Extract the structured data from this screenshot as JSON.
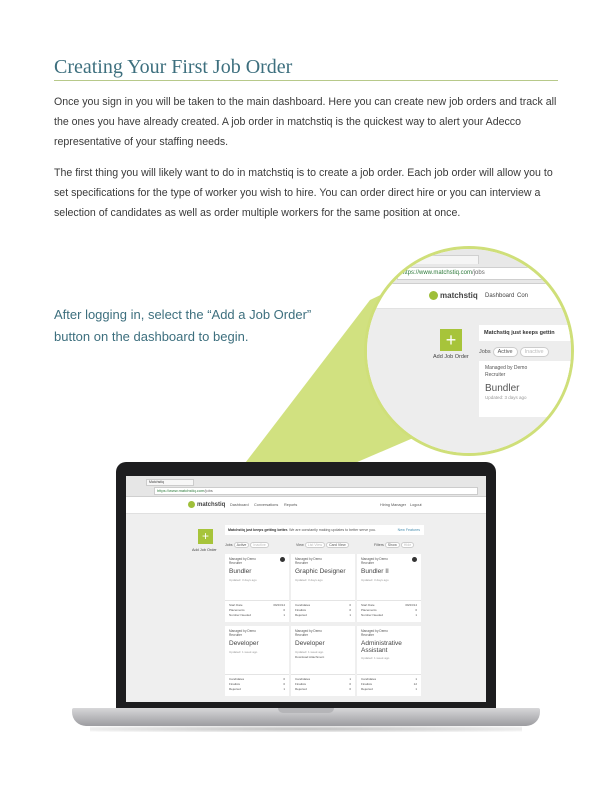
{
  "page": {
    "title": "Creating Your First Job Order",
    "paragraph1": "Once you sign in you will be taken to the main dashboard. Here you can create new job orders and track all the ones you have already created. A job order in matchstiq is the quickest way to alert your Adecco representative of your staffing needs.",
    "paragraph2": "The first thing you will likely want to do in matchstiq is to create a job order. Each job order will allow you to set specifications for the type of worker you wish to hire. You can order direct hire or you can interview a selection of candidates as well as order multiple workers for the same position at once.",
    "callout": "After logging in, select the “Add a Job Order” button on the dashboard to begin.",
    "accent_color": "#a7c43a",
    "title_color": "#3d6f7e"
  },
  "magnifier": {
    "url_host": "https://www.matchstiq.com",
    "url_path": "/jobs",
    "logo": "matchstiq",
    "nav_dashboard": "Dashboard",
    "nav_partial": "Con",
    "add_icon": "+",
    "add_label": "Add Job Order",
    "banner": "Matchstiq just keeps gettin",
    "jobs_label": "Jobs",
    "pill_active": "Active",
    "pill_inactive": "Inactive",
    "card_managed": "Managed by Demo",
    "card_recruiter": "Recruiter",
    "card_title": "Bundler",
    "card_updated": "Updated: 3 days ago"
  },
  "screen": {
    "tab": "Matchstiq",
    "url_host": "https://www.matchstiq.com",
    "url_path": "/jobs",
    "logo": "matchstiq",
    "nav": [
      "Dashboard",
      "Conversations",
      "Reports"
    ],
    "user": "Hiring Manager",
    "logout": "Logout",
    "add_icon": "+",
    "add_label": "Add Job Order",
    "banner_bold": "Matchstiq just keeps getting better.",
    "banner_text": "We are constantly making updates to better serve you.",
    "banner_link": "New Features",
    "jobs_label": "Jobs",
    "jobs_active": "Active",
    "jobs_inactive": "Inactive",
    "view_label": "View",
    "view_list": "List View",
    "view_card": "Card View",
    "filters_label": "Filters",
    "filter_show": "Show",
    "filter_hide": "Hide",
    "cards": [
      {
        "managed": "Managed by Demo",
        "recruiter": "Recruiter",
        "title": "Bundler",
        "updated": "Updated: 3 days ago",
        "extra": "",
        "stats": [
          [
            "Start Date",
            "09/23/14"
          ],
          [
            "Placements",
            "0"
          ],
          [
            "Number Needed",
            "1"
          ]
        ]
      },
      {
        "managed": "Managed by Demo",
        "recruiter": "Recruiter",
        "title": "Graphic Designer",
        "updated": "Updated: 3 days ago",
        "extra": "",
        "stats": [
          [
            "Candidates",
            "0"
          ],
          [
            "Finalists",
            "0"
          ],
          [
            "Rejected",
            "1"
          ]
        ]
      },
      {
        "managed": "Managed by Demo",
        "recruiter": "Recruiter",
        "title": "Bundler II",
        "updated": "Updated: 3 days ago",
        "extra": "",
        "stats": [
          [
            "Start Date",
            "09/23/14"
          ],
          [
            "Placements",
            "0"
          ],
          [
            "Number Needed",
            "1"
          ]
        ]
      },
      {
        "managed": "Managed by Demo",
        "recruiter": "Recruiter",
        "title": "Developer",
        "updated": "Updated: 1 week ago",
        "extra": "",
        "stats": [
          [
            "Candidates",
            "0"
          ],
          [
            "Finalists",
            "0"
          ],
          [
            "Rejected",
            "1"
          ]
        ]
      },
      {
        "managed": "Managed by Demo",
        "recruiter": "Recruiter",
        "title": "Developer",
        "updated": "Updated: 1 week ago",
        "extra": "Download Attachment",
        "stats": [
          [
            "Candidates",
            "1"
          ],
          [
            "Finalists",
            "0"
          ],
          [
            "Rejected",
            "0"
          ]
        ]
      },
      {
        "managed": "Managed by Demo",
        "recruiter": "Recruiter",
        "title": "Administrative Assistant",
        "updated": "Updated: 1 week ago",
        "extra": "",
        "stats": [
          [
            "Candidates",
            "1"
          ],
          [
            "Finalists",
            "12"
          ],
          [
            "Rejected",
            "1"
          ]
        ]
      }
    ]
  }
}
